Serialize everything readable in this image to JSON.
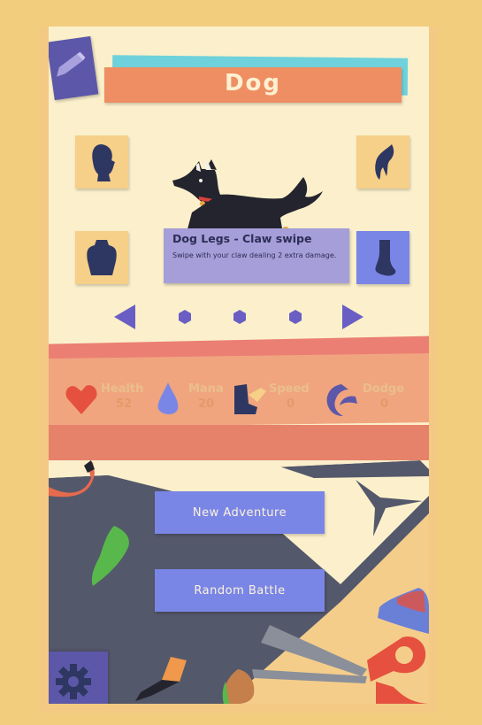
{
  "character": {
    "name": "Dog"
  },
  "ability": {
    "title": "Dog Legs - Claw swipe",
    "description": "Swipe with your claw dealing 2 extra damage."
  },
  "pagination": {
    "total": 3
  },
  "stats": [
    {
      "name": "Health",
      "value": "52",
      "icon": "heart-icon"
    },
    {
      "name": "Mana",
      "value": "20",
      "icon": "mana-drop-icon"
    },
    {
      "name": "Speed",
      "value": "0",
      "icon": "winged-boot-icon"
    },
    {
      "name": "Dodge",
      "value": "0",
      "icon": "swirl-icon"
    }
  ],
  "menu": {
    "new_adventure": "New Adventure",
    "random_battle": "Random Battle"
  },
  "colors": {
    "accent_blue": "#7a86e6",
    "title_banner": "#ef8e63",
    "panel": "#fbf0cb",
    "tooltip": "#a59ed9"
  }
}
